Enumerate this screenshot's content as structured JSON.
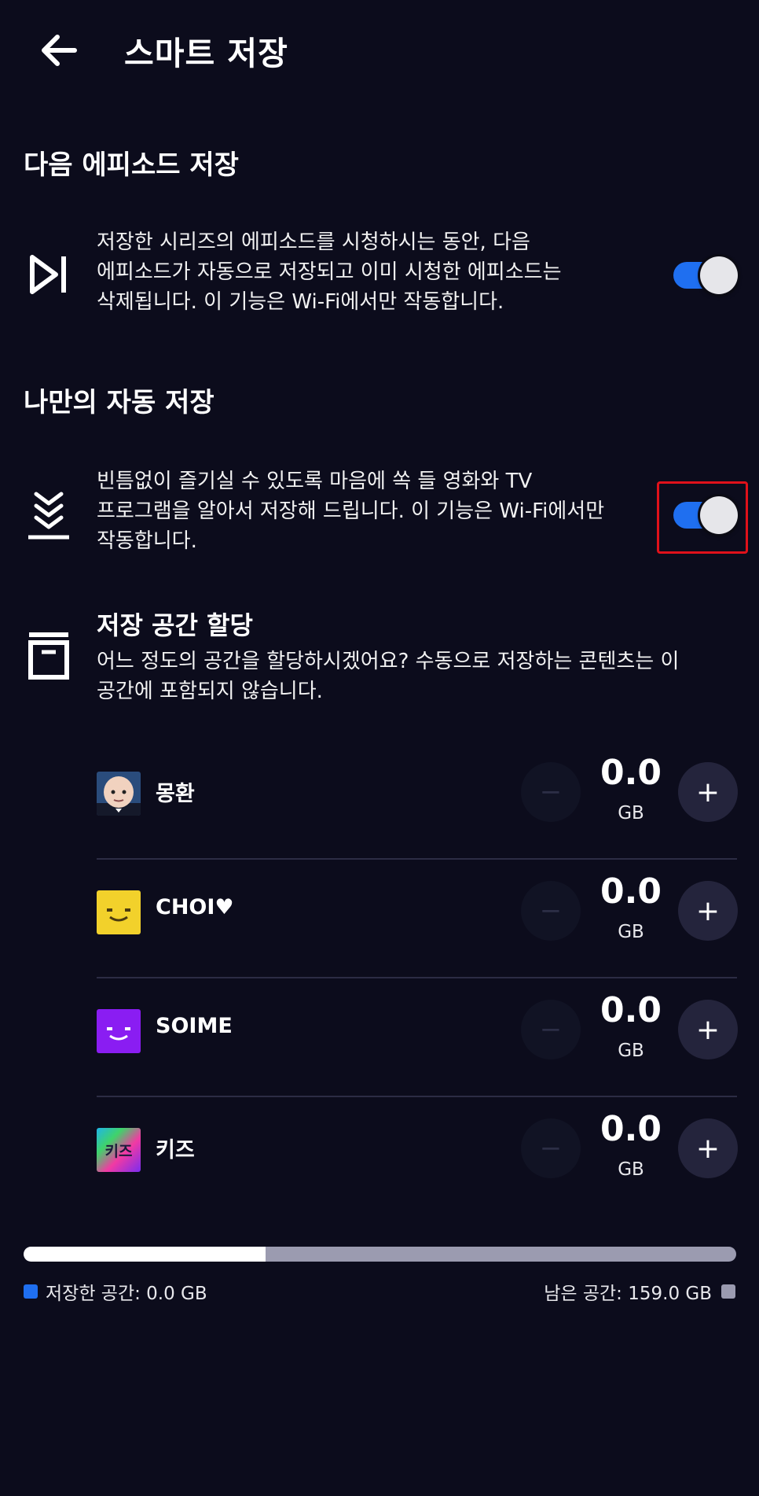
{
  "header": {
    "title": "스마트 저장"
  },
  "next_episode": {
    "section_title": "다음 에피소드 저장",
    "description": [
      "저장한 시리즈의 에피소드를 시청하시는 동안, 다음",
      "에피소드가 자동으로 저장되고 이미 시청한 에피소드는",
      "삭제됩니다. 이 기능은 Wi-Fi에서만 작동합니다."
    ],
    "enabled": true
  },
  "auto_download": {
    "section_title": "나만의 자동 저장",
    "description": [
      "빈틈없이 즐기실 수 있도록 마음에 쏙 들 영화와 TV",
      "프로그램을 알아서 저장해 드립니다. 이 기능은 Wi-Fi에서만",
      "작동합니다."
    ],
    "enabled": true
  },
  "allocation": {
    "title": "저장 공간 할당",
    "description": [
      "어느 정도의 공간을 할당하시겠어요? 수동으로 저장하는 콘텐츠는 이",
      "공간에 포함되지 않습니다."
    ],
    "profiles": [
      {
        "name": "몽환",
        "value": "0.0",
        "unit": "GB",
        "avatar": "baby-boss"
      },
      {
        "name": "CHOI♥",
        "value": "0.0",
        "unit": "GB",
        "avatar": "yellow-smile"
      },
      {
        "name": "SOIME",
        "value": "0.0",
        "unit": "GB",
        "avatar": "purple-smile"
      },
      {
        "name": "키즈",
        "value": "0.0",
        "unit": "GB",
        "avatar": "kids"
      }
    ],
    "minus_symbol": "−",
    "plus_symbol": "+"
  },
  "storage": {
    "used_label": "저장한 공간: 0.0 GB",
    "remaining_label": "남은 공간: 159.0 GB",
    "bar_fraction": 0.34,
    "used_color": "#1f6ff0",
    "remaining_color": "#9b9bb0"
  },
  "kids_avatar_text": "키즈"
}
